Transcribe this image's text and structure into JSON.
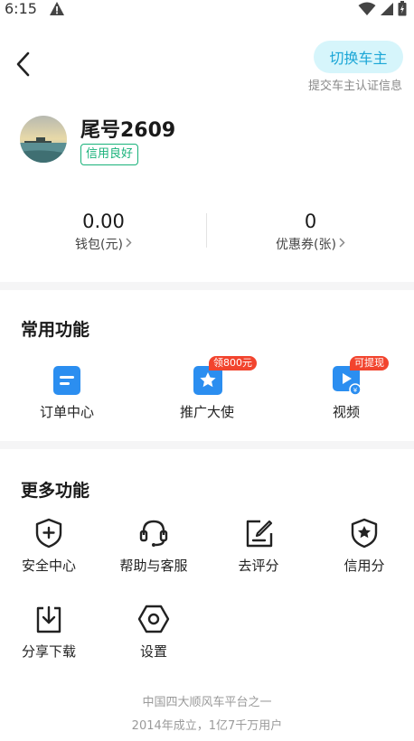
{
  "status_bar": {
    "time": "6:15"
  },
  "header": {
    "switch_button": "切换车主",
    "switch_sub": "提交车主认证信息"
  },
  "profile": {
    "nickname": "尾号2609",
    "credit_badge": "信用良好"
  },
  "stats": {
    "wallet_value": "0.00",
    "wallet_label": "钱包(元)",
    "coupon_value": "0",
    "coupon_label": "优惠券(张)"
  },
  "common": {
    "title": "常用功能",
    "items": [
      {
        "label": "订单中心",
        "icon": "order-icon",
        "tag": ""
      },
      {
        "label": "推广大使",
        "icon": "ambassador-icon",
        "tag": "领800元"
      },
      {
        "label": "视频",
        "icon": "video-icon",
        "tag": "可提现"
      }
    ]
  },
  "more": {
    "title": "更多功能",
    "items": [
      {
        "label": "安全中心",
        "icon": "shield-plus-icon"
      },
      {
        "label": "帮助与客服",
        "icon": "headset-icon"
      },
      {
        "label": "去评分",
        "icon": "edit-icon"
      },
      {
        "label": "信用分",
        "icon": "shield-star-icon"
      },
      {
        "label": "分享下载",
        "icon": "download-icon"
      },
      {
        "label": "设置",
        "icon": "settings-icon"
      }
    ]
  },
  "footer": {
    "line1": "中国四大顺风车平台之一",
    "line2": "2014年成立，1亿7千万用户"
  },
  "colors": {
    "accent_blue": "#2b8ef0",
    "switch_bg": "#d6f5fb",
    "switch_text": "#1aa6d6",
    "credit_green": "#18b27a",
    "tag_red": "#f2442e"
  }
}
